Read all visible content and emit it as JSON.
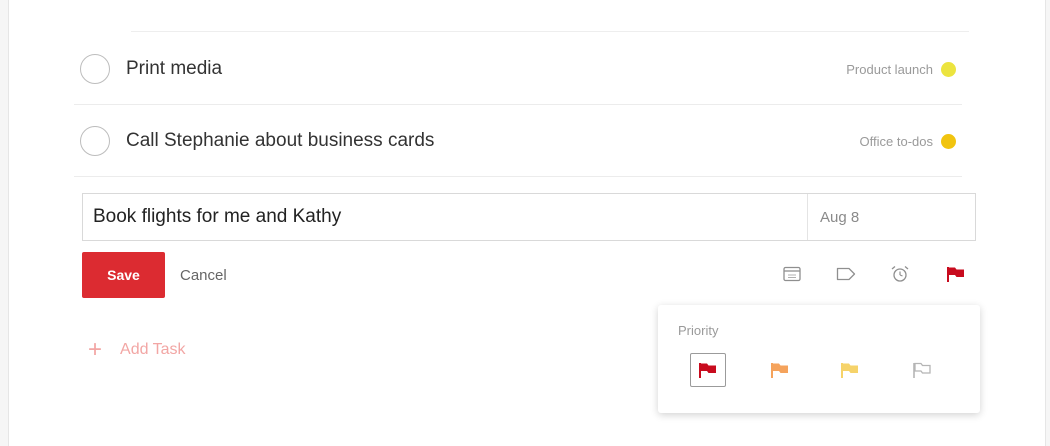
{
  "tasks": [
    {
      "title": "Print media",
      "project": "Product launch",
      "project_color": "#ece43f"
    },
    {
      "title": "Call Stephanie about business cards",
      "project": "Office to-dos",
      "project_color": "#f1c40f"
    }
  ],
  "editor": {
    "value": "Book flights for me and Kathy",
    "date": "Aug 8"
  },
  "actions": {
    "save_label": "Save",
    "cancel_label": "Cancel"
  },
  "toolbar_icons": [
    "calendar-icon",
    "label-icon",
    "reminder-alarm-icon",
    "priority-flag-icon"
  ],
  "add_task": {
    "label": "Add Task"
  },
  "priority": {
    "title": "Priority",
    "options": [
      {
        "level": 1,
        "color": "#c80b1e",
        "selected": true
      },
      {
        "level": 2,
        "color": "#f5a35c",
        "selected": false
      },
      {
        "level": 3,
        "color": "#f6d36a",
        "selected": false
      },
      {
        "level": 4,
        "color": "#b5b5b5",
        "selected": false
      }
    ]
  },
  "colors": {
    "accent": "#dc2b31"
  }
}
